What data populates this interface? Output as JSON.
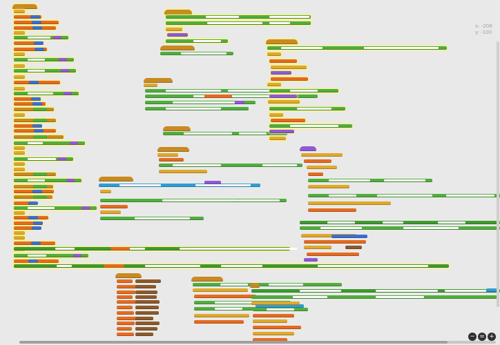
{
  "app": {
    "workspace": "blocks editor canvas"
  },
  "coords": {
    "x_label": "x: -208",
    "y_label": "y: -100"
  },
  "zoom_controls": {
    "zoom_out": "−",
    "reset": "=",
    "zoom_in": "+"
  },
  "colors": {
    "event": "#c98a20",
    "control": "#e0a92b",
    "text": "#51ae3c",
    "text_dark": "#3f9a2f",
    "string": "#ffffff",
    "procedure": "#8e5ad6",
    "component": "#2e9ed6",
    "variable": "#e56b1f",
    "math": "#3d6fd1",
    "list": "#8b5a2b",
    "canvas": "#e9e9e9"
  }
}
